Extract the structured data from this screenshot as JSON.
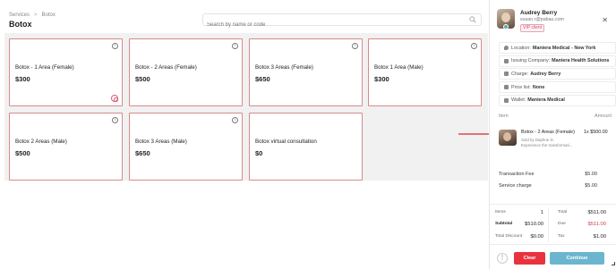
{
  "breadcrumb": {
    "parent": "Services",
    "separator": ">",
    "current": "Botox"
  },
  "page_title": "Botox",
  "search": {
    "placeholder": "Search by name or code"
  },
  "services": [
    {
      "title": "Botox - 1 Area (Female)",
      "price": "$300"
    },
    {
      "title": "Botox - 2 Areas (Female)",
      "price": "$500"
    },
    {
      "title": "Botox 3 Areas (Female)",
      "price": "$650"
    },
    {
      "title": "Botox 1 Area (Male)",
      "price": "$300"
    },
    {
      "title": "Botox 2 Areas (Male)",
      "price": "$500"
    },
    {
      "title": "Botox 3 Areas (Male)",
      "price": "$650"
    },
    {
      "title": "Botox virtual consultation",
      "price": "$0"
    }
  ],
  "client": {
    "name": "Audrey Berry",
    "email": "susan.r@pabau.com",
    "badge": "VIP client"
  },
  "details": [
    {
      "label": "Location:",
      "value": "Maniera Medical - New York"
    },
    {
      "label": "Issuing Company:",
      "value": "Maniera Health Solutions"
    },
    {
      "label": "Charge:",
      "value": "Audrey Berry"
    },
    {
      "label": "Price list:",
      "value": "None"
    },
    {
      "label": "Wallet:",
      "value": "Maniera Medical"
    }
  ],
  "items_header": {
    "item": "Item",
    "amount": "Amount"
  },
  "line_item": {
    "title": "Botox - 2 Areas (Female)",
    "qty_price": "1x $500.00",
    "sold_by": "Sold by Daphne D.",
    "description": "Experience the transformati..."
  },
  "fees": [
    {
      "label": "Transaction Fee",
      "value": "$5.00"
    },
    {
      "label": "Service charge",
      "value": "$5.00"
    }
  ],
  "totals": {
    "items_label": "Items",
    "items_value": "1",
    "subtotal_label": "Subtotal",
    "subtotal_value": "$510.00",
    "discount_label": "Total Discount",
    "discount_value": "$0.00",
    "total_label": "Total",
    "total_value": "$511.00",
    "due_label": "Due",
    "due_value": "$511.00",
    "tax_label": "Tax",
    "tax_value": "$1.00"
  },
  "buttons": {
    "more": "⋮",
    "clear": "Clear",
    "continue": "Continue"
  },
  "colors": {
    "accent_red": "#e8333f",
    "continue_blue": "#6bb6ce",
    "card_border": "#d88a8a"
  }
}
